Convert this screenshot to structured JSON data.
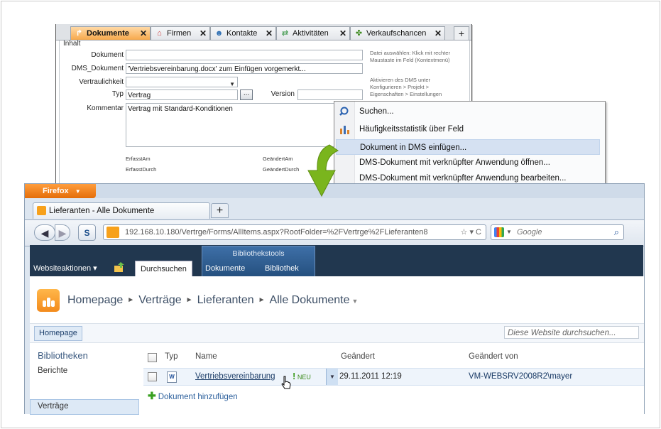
{
  "crm": {
    "tabs": [
      {
        "label": "Dokumente",
        "icon": "document-icon"
      },
      {
        "label": "Firmen",
        "icon": "home-icon"
      },
      {
        "label": "Kontakte",
        "icon": "people-icon"
      },
      {
        "label": "Aktivitäten",
        "icon": "arrows-icon"
      },
      {
        "label": "Verkaufschancen",
        "icon": "clover-icon"
      }
    ],
    "add_tab": "+",
    "close_glyph": "✕",
    "group_title": "Inhalt",
    "fields": {
      "dokument_label": "Dokument",
      "dokument_value": "",
      "dms_label": "DMS_Dokument",
      "dms_value": "'Vertriebsvereinbarung.docx' zum Einfügen vorgemerkt...",
      "vertraulichkeit_label": "Vertraulichkeit",
      "vertraulichkeit_value": "",
      "typ_label": "Typ",
      "typ_value": "Vertrag",
      "typ_button": "...",
      "version_label": "Version",
      "version_value": "",
      "kommentar_label": "Kommentar",
      "kommentar_value": "Vertrag mit Standard-Konditionen",
      "erfasst_am": "ErfasstAm",
      "erfasst_durch": "ErfasstDurch",
      "geaendert_am": "GeändertAm",
      "geaendert_durch": "GeändertDurch"
    },
    "hints": {
      "hint1": "Datei auswählen: Klick mit rechter Maustaste im Feld (Kontextmenü)",
      "hint2": "Aktivieren des DMS unter Konfigurieren > Projekt > Eigenschaften > Einstellungen"
    }
  },
  "context_menu": [
    {
      "label": "Suchen...",
      "icon": "search-icon",
      "highlighted": false
    },
    {
      "label": "Häufigkeitsstatistik über Feld",
      "icon": "bar-chart-icon",
      "highlighted": false
    },
    {
      "label": "Dokument in DMS einfügen...",
      "icon": "",
      "highlighted": true
    },
    {
      "label": "DMS-Dokument mit verknüpfter Anwendung öffnen...",
      "icon": "",
      "highlighted": false
    },
    {
      "label": "DMS-Dokument mit verknüpfter Anwendung bearbeiten...",
      "icon": "",
      "highlighted": false
    }
  ],
  "firefox": {
    "menu_button": "Firefox",
    "tab_title": "Lieferanten - Alle Dokumente",
    "new_tab": "+",
    "back": "◀",
    "forward": "▶",
    "url": "192.168.10.180/Vertrge/Forms/AllItems.aspx?RootFolder=%2FVertrge%2FLieferanten8",
    "url_controls": "☆ ▾ C",
    "search_placeholder": "Google",
    "search_icon": "⌕"
  },
  "sharepoint": {
    "site_actions": "Websiteaktionen ▾",
    "ribbon_group": "Bibliothekstools",
    "tabs": [
      "Durchsuchen",
      "Dokumente",
      "Bibliothek"
    ],
    "breadcrumb": [
      "Homepage",
      "Verträge",
      "Lieferanten",
      "Alle Dokumente"
    ],
    "breadcrumb_sep": "►",
    "home_pill": "Homepage",
    "search_placeholder": "Diese Website durchsuchen...",
    "quicklaunch": {
      "header": "Bibliotheken",
      "items": [
        "Berichte",
        "Verträge"
      ]
    },
    "columns": {
      "typ": "Typ",
      "name": "Name",
      "geaendert": "Geändert",
      "geaendert_von": "Geändert von"
    },
    "rows": [
      {
        "name": "Vertriebsvereinbarung",
        "new": "NEU",
        "modified": "29.11.2011 12:19",
        "modified_by": "VM-WEBSRV2008R2\\mayer",
        "type_icon": "word-document-icon"
      }
    ],
    "add_document": "Dokument hinzufügen"
  },
  "colors": {
    "ribbon": "#21374f",
    "firefox_orange": "#e46d09",
    "active_tab": "#f7a94c",
    "arrow_green": "#7ab51d"
  }
}
